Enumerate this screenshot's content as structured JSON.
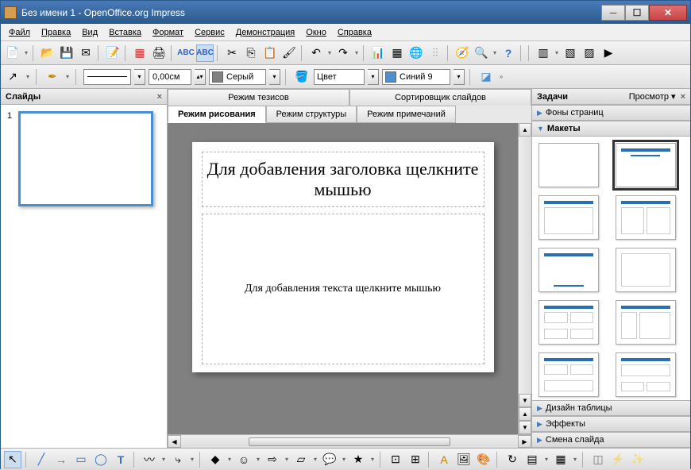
{
  "window": {
    "title": "Без имени 1 - OpenOffice.org Impress"
  },
  "menu": {
    "file": "Файл",
    "edit": "Правка",
    "view": "Вид",
    "insert": "Вставка",
    "format": "Формат",
    "tools": "Сервис",
    "demo": "Демонстрация",
    "window": "Окно",
    "help": "Справка"
  },
  "toolbar2": {
    "width": "0,00см",
    "gray": "Серый",
    "color_label": "Цвет",
    "blue": "Синий 9"
  },
  "slides_panel": {
    "title": "Слайды",
    "slide_number": "1"
  },
  "tasks_panel": {
    "title": "Задачи",
    "view": "Просмотр",
    "sections": {
      "backgrounds": "Фоны страниц",
      "layouts": "Макеты",
      "table_design": "Дизайн таблицы",
      "effects": "Эффекты",
      "transition": "Смена слайда"
    }
  },
  "tabs": {
    "outline_mode": "Режим тезисов",
    "slide_sorter": "Сортировщик слайдов",
    "drawing": "Режим рисования",
    "structure": "Режим структуры",
    "notes": "Режим примечаний"
  },
  "slide": {
    "title_placeholder": "Для добавления заголовка щелкните мышью",
    "body_placeholder": "Для добавления текста щелкните мышью"
  }
}
